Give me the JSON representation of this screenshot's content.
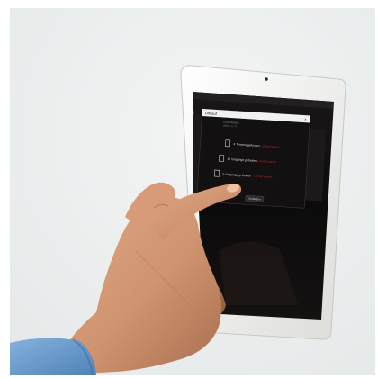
{
  "photo": {
    "backdrop_color": "#eef0f0",
    "tablet_color": "#f4f4f2",
    "screen_color": "#0c0b0b",
    "sleeve_color": "#6f9fd0",
    "accent_color": "#b4191c"
  },
  "dialog": {
    "title": "Umlauf",
    "subtitle": "Umlaufstatus",
    "subtitle_sub": "Aktion 1 / 3",
    "items": [
      {
        "icon": "document-icon",
        "label": "4 Termine gefunden",
        "link": "› Umlauf starten"
      },
      {
        "icon": "document-icon",
        "label": "12 Vorgänge gefunden",
        "link": "› Umlauf starten"
      },
      {
        "icon": "document-icon",
        "label": "5 Vorgänge gefunden",
        "link": "› Umlauf starten"
      }
    ],
    "button_label": "Schließen"
  }
}
